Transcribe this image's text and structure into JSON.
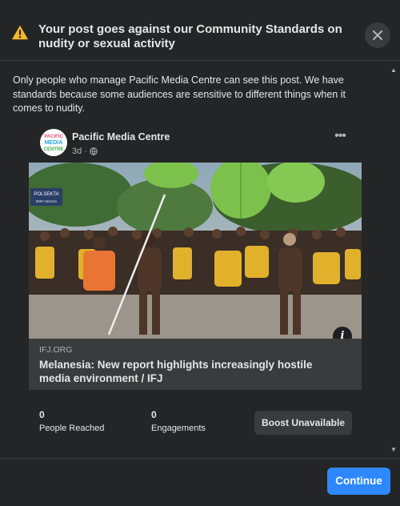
{
  "header": {
    "title": "Your post goes against our Community Standards on nudity or sexual activity",
    "warning_icon": "warning-triangle-icon",
    "close_icon": "close-icon"
  },
  "explanation": "Only people who manage Pacific Media Centre can see this post. We have standards because some audiences are sensitive to different things when it comes to nudity.",
  "post": {
    "page_name": "Pacific Media Centre",
    "time": "3d",
    "privacy_icon": "globe-icon",
    "avatar_text": [
      "PACIFIC",
      "MEDIA",
      "CENTRE"
    ],
    "image_signs": [
      "POLSEKTA",
      "0987-664101"
    ],
    "link": {
      "domain": "IFJ.ORG",
      "headline": "Melanesia: New report highlights increasingly hostile media environment / IFJ"
    },
    "stats": [
      {
        "value": "0",
        "label": "People Reached"
      },
      {
        "value": "0",
        "label": "Engagements"
      }
    ],
    "boost_label": "Boost Unavailable",
    "info_label": "i"
  },
  "footer": {
    "continue_label": "Continue"
  },
  "colors": {
    "background": "#242526",
    "accent": "#2d88ff",
    "warning": "#f7b928"
  }
}
